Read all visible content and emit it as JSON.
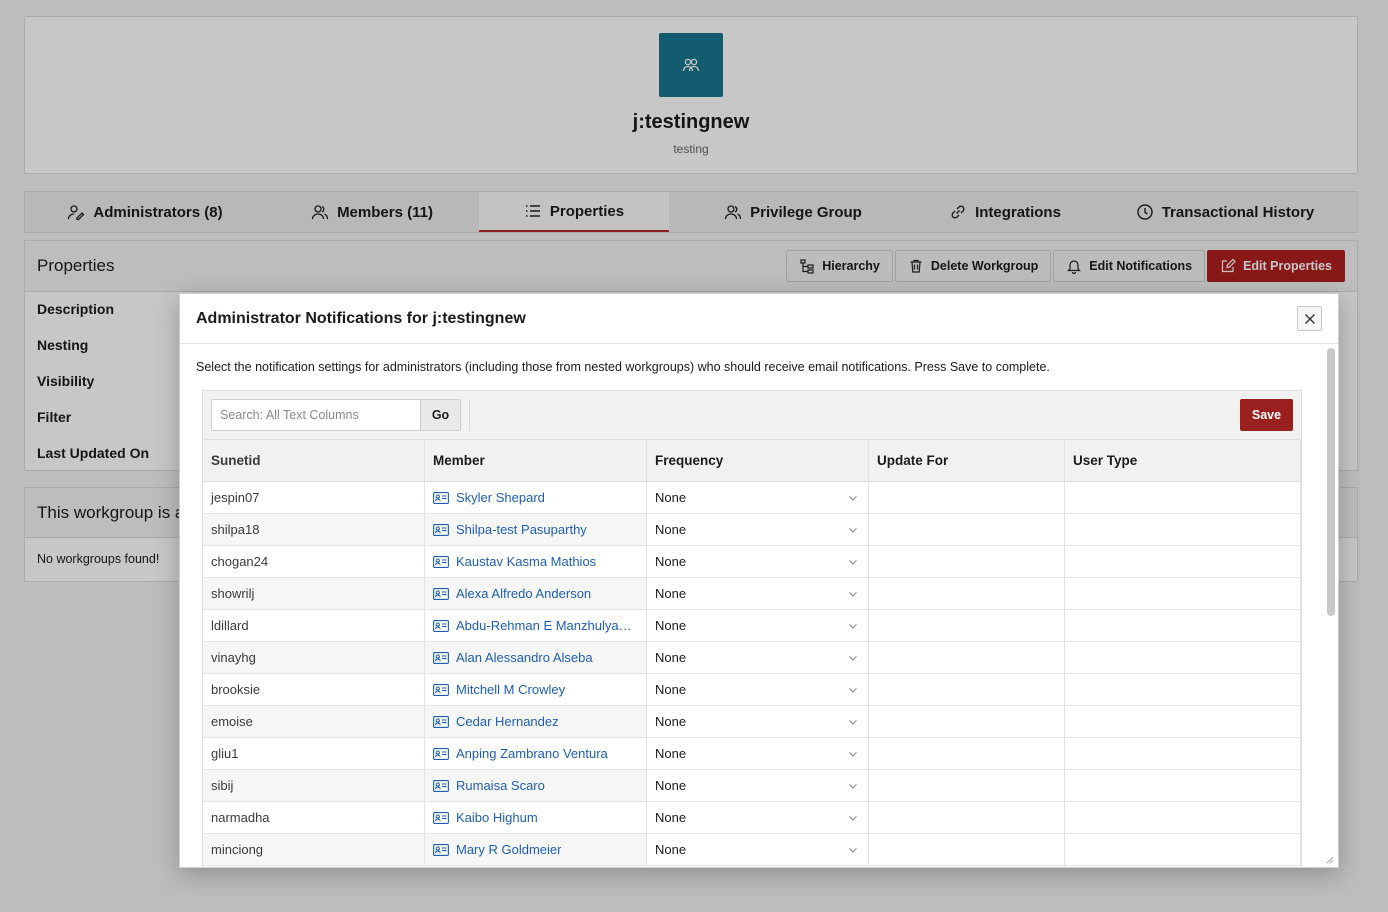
{
  "profile": {
    "title": "j:testingnew",
    "subtitle": "testing",
    "avatar_icon": "group-icon"
  },
  "tabs": [
    {
      "label": "Administrators (8)",
      "icon": "admin-icon"
    },
    {
      "label": "Members (11)",
      "icon": "members-icon"
    },
    {
      "label": "Properties",
      "icon": "list-icon",
      "active": true
    },
    {
      "label": "Privilege Group",
      "icon": "privilege-icon"
    },
    {
      "label": "Integrations",
      "icon": "link-icon"
    },
    {
      "label": "Transactional History",
      "icon": "clock-icon"
    }
  ],
  "properties": {
    "title": "Properties",
    "actions": {
      "hierarchy": "Hierarchy",
      "delete": "Delete Workgroup",
      "notifications": "Edit Notifications",
      "edit": "Edit Properties"
    },
    "labels": [
      "Description",
      "Nesting",
      "Visibility",
      "Filter",
      "Last Updated On"
    ]
  },
  "nested": {
    "title": "This workgroup is a",
    "empty": "No workgroups found!"
  },
  "modal": {
    "title": "Administrator Notifications for j:testingnew",
    "description": "Select the notification settings for administrators (including those from nested workgroups) who should receive email notifications. Press Save to complete.",
    "search_placeholder": "Search: All Text Columns",
    "go_label": "Go",
    "save_label": "Save",
    "columns": [
      "Sunetid",
      "Member",
      "Frequency",
      "Update For",
      "User Type"
    ],
    "rows": [
      {
        "sunetid": "jespin07",
        "member": "Skyler Shepard",
        "frequency": "None"
      },
      {
        "sunetid": "shilpa18",
        "member": "Shilpa-test Pasuparthy",
        "frequency": "None"
      },
      {
        "sunetid": "chogan24",
        "member": "Kaustav Kasma Mathios",
        "frequency": "None"
      },
      {
        "sunetid": "showrilj",
        "member": "Alexa Alfredo Anderson",
        "frequency": "None"
      },
      {
        "sunetid": "ldillard",
        "member": "Abdu-Rehman E Manzhulya…",
        "frequency": "None"
      },
      {
        "sunetid": "vinayhg",
        "member": "Alan Alessandro Alseba",
        "frequency": "None"
      },
      {
        "sunetid": "brooksie",
        "member": "Mitchell M Crowley",
        "frequency": "None"
      },
      {
        "sunetid": "emoise",
        "member": "Cedar Hernandez",
        "frequency": "None"
      },
      {
        "sunetid": "gliu1",
        "member": "Anping Zambrano Ventura",
        "frequency": "None"
      },
      {
        "sunetid": "sibij",
        "member": "Rumaisa Scaro",
        "frequency": "None"
      },
      {
        "sunetid": "narmadha",
        "member": "Kaibo Highum",
        "frequency": "None"
      },
      {
        "sunetid": "minciong",
        "member": "Mary R Goldmeier",
        "frequency": "None"
      }
    ]
  },
  "colors": {
    "accent": "#b01f1f",
    "avatar": "#19778f",
    "link": "#1d5fb4"
  }
}
